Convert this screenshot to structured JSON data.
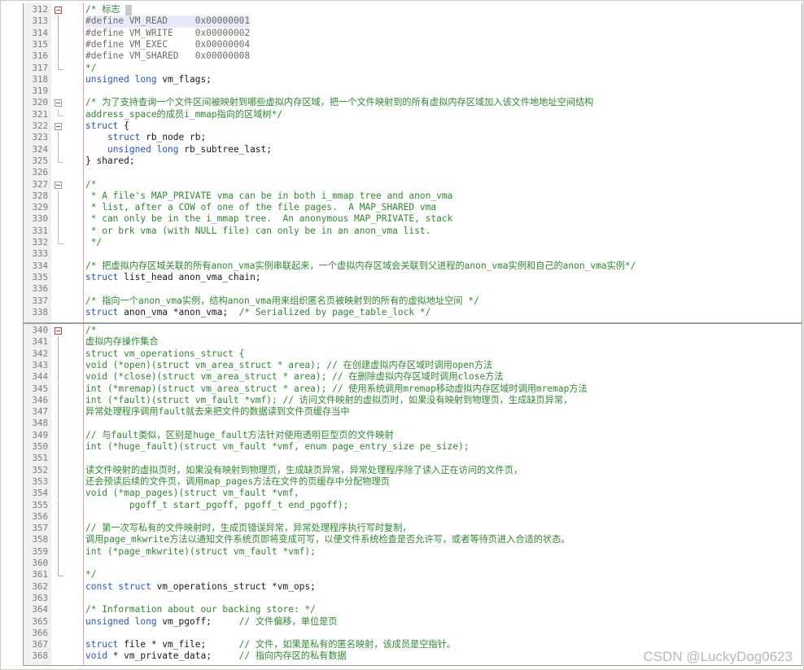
{
  "editor": {
    "watermark": "CSDN @LuckyDog0623",
    "colors": {
      "comment": "#2e8b2e",
      "keyword": "#2456c8",
      "line_number": "#7a7a7a",
      "highlight": "#e8eaf8",
      "fold_marker": "#d24040"
    },
    "panel_a": [
      {
        "n": "312",
        "fold": "open-red",
        "segs": [
          {
            "t": "/* 标志 ",
            "c": "cm"
          }
        ],
        "caret": true
      },
      {
        "n": "313",
        "fold": "line-red",
        "hl": true,
        "segs": [
          {
            "t": "#define VM_READ     0x00000001",
            "c": "pp"
          }
        ]
      },
      {
        "n": "314",
        "fold": "line-red",
        "segs": [
          {
            "t": "#define VM_WRITE    0x00000002",
            "c": "pp"
          }
        ]
      },
      {
        "n": "315",
        "fold": "line-red",
        "segs": [
          {
            "t": "#define VM_EXEC     0x00000004",
            "c": "pp"
          }
        ]
      },
      {
        "n": "316",
        "fold": "line-red",
        "segs": [
          {
            "t": "#define VM_SHARED   0x00000008",
            "c": "pp"
          }
        ]
      },
      {
        "n": "317",
        "fold": "end-red",
        "segs": [
          {
            "t": "*/",
            "c": "cm"
          }
        ]
      },
      {
        "n": "318",
        "fold": "",
        "segs": [
          {
            "t": "unsigned long",
            "c": "kw"
          },
          {
            "t": " vm_flags;",
            "c": "id"
          }
        ]
      },
      {
        "n": "319",
        "fold": "",
        "segs": []
      },
      {
        "n": "320",
        "fold": "open",
        "segs": [
          {
            "t": "/* 为了支持查询一个文件区间被映射到哪些虚拟内存区域，把一个文件映射到的所有虚拟内存区域加入该文件地地址空间结构",
            "c": "cm"
          }
        ]
      },
      {
        "n": "321",
        "fold": "end",
        "segs": [
          {
            "t": "address_space的成员i_mmap指向的区域树*/",
            "c": "cm"
          }
        ]
      },
      {
        "n": "322",
        "fold": "open",
        "segs": [
          {
            "t": "struct",
            "c": "kw"
          },
          {
            "t": " {",
            "c": "id"
          }
        ]
      },
      {
        "n": "323",
        "fold": "line",
        "segs": [
          {
            "t": "    ",
            "c": "id"
          },
          {
            "t": "struct",
            "c": "kw"
          },
          {
            "t": " rb_node rb;",
            "c": "id"
          }
        ]
      },
      {
        "n": "324",
        "fold": "line",
        "segs": [
          {
            "t": "    ",
            "c": "id"
          },
          {
            "t": "unsigned long",
            "c": "kw"
          },
          {
            "t": " rb_subtree_last;",
            "c": "id"
          }
        ]
      },
      {
        "n": "325",
        "fold": "end",
        "segs": [
          {
            "t": "} shared;",
            "c": "id"
          }
        ]
      },
      {
        "n": "326",
        "fold": "",
        "segs": []
      },
      {
        "n": "327",
        "fold": "open",
        "segs": [
          {
            "t": "/*",
            "c": "cm"
          }
        ]
      },
      {
        "n": "328",
        "fold": "line",
        "segs": [
          {
            "t": " * A file's MAP_PRIVATE vma can be in both i_mmap tree and anon_vma",
            "c": "cm"
          }
        ]
      },
      {
        "n": "329",
        "fold": "line",
        "segs": [
          {
            "t": " * list, after a COW of one of the file pages.  A MAP_SHARED vma",
            "c": "cm"
          }
        ]
      },
      {
        "n": "330",
        "fold": "line",
        "segs": [
          {
            "t": " * can only be in the i_mmap tree.  An anonymous MAP_PRIVATE, stack",
            "c": "cm"
          }
        ]
      },
      {
        "n": "331",
        "fold": "line",
        "segs": [
          {
            "t": " * or brk vma (with NULL file) can only be in an anon_vma list.",
            "c": "cm"
          }
        ]
      },
      {
        "n": "332",
        "fold": "end",
        "segs": [
          {
            "t": " */",
            "c": "cm"
          }
        ]
      },
      {
        "n": "333",
        "fold": "",
        "segs": []
      },
      {
        "n": "334",
        "fold": "",
        "segs": [
          {
            "t": "/* 把虚拟内存区域关联的所有anon_vma实例串联起来，一个虚拟内存区域会关联到父进程的anon_vma实例和自己的anon_vma实例*/",
            "c": "cm"
          }
        ]
      },
      {
        "n": "335",
        "fold": "",
        "segs": [
          {
            "t": "struct",
            "c": "kw"
          },
          {
            "t": " list_head anon_vma_chain;",
            "c": "id"
          }
        ]
      },
      {
        "n": "336",
        "fold": "",
        "segs": []
      },
      {
        "n": "337",
        "fold": "",
        "segs": [
          {
            "t": "/* 指向一个anon_vma实例，结构anon_vma用来组织匿名页被映射到的所有的虚拟地址空间 */",
            "c": "cm"
          }
        ]
      },
      {
        "n": "338",
        "fold": "",
        "segs": [
          {
            "t": "struct",
            "c": "kw"
          },
          {
            "t": " anon_vma *anon_vma;  ",
            "c": "id"
          },
          {
            "t": "/* Serialized by page_table_lock */",
            "c": "cm"
          }
        ]
      }
    ],
    "panel_b": [
      {
        "n": "340",
        "fold": "open-red",
        "segs": [
          {
            "t": "/*",
            "c": "cm"
          }
        ]
      },
      {
        "n": "341",
        "fold": "line-red",
        "segs": [
          {
            "t": "虚拟内存操作集合",
            "c": "cm"
          }
        ]
      },
      {
        "n": "342",
        "fold": "line-red",
        "segs": [
          {
            "t": "struct vm_operations_struct {",
            "c": "cm"
          }
        ]
      },
      {
        "n": "343",
        "fold": "line-red",
        "segs": [
          {
            "t": "void (*open)(struct vm_area_struct * area); // 在创建虚拟内存区域时调用open方法",
            "c": "cm"
          }
        ]
      },
      {
        "n": "344",
        "fold": "line-red",
        "segs": [
          {
            "t": "void (*close)(struct vm_area_struct * area); // 在删除虚拟内存区域时调用close方法",
            "c": "cm"
          }
        ]
      },
      {
        "n": "345",
        "fold": "line-red",
        "segs": [
          {
            "t": "int (*mremap)(struct vm_area_struct * area); // 使用系统调用mremap移动虚拟内存区域时调用mremap方法",
            "c": "cm"
          }
        ]
      },
      {
        "n": "346",
        "fold": "line-red",
        "segs": [
          {
            "t": "int (*fault)(struct vm_fault *vmf); // 访问文件映射的虚拟页时，如果没有映射到物理页，生成缺页异常，",
            "c": "cm"
          }
        ]
      },
      {
        "n": "347",
        "fold": "line-red",
        "segs": [
          {
            "t": "异常处理程序调用fault就去来把文件的数据读到文件页缓存当中",
            "c": "cm"
          }
        ]
      },
      {
        "n": "348",
        "fold": "line-red",
        "segs": []
      },
      {
        "n": "349",
        "fold": "line-red",
        "segs": [
          {
            "t": "// 与fault类似，区别是huge_fault方法针对使用透明巨型页的文件映射",
            "c": "cm"
          }
        ]
      },
      {
        "n": "350",
        "fold": "line-red",
        "segs": [
          {
            "t": "int (*huge_fault)(struct vm_fault *vmf, enum page_entry_size pe_size);",
            "c": "cm"
          }
        ]
      },
      {
        "n": "351",
        "fold": "line-red",
        "segs": []
      },
      {
        "n": "352",
        "fold": "line-red",
        "segs": [
          {
            "t": "读文件映射的虚拟页时，如果没有映射到物理页，生成缺页异常，异常处理程序除了读入正在访问的文件页，",
            "c": "cm"
          }
        ]
      },
      {
        "n": "353",
        "fold": "line-red",
        "segs": [
          {
            "t": "还会预读后续的文件页，调用map_pages方法在文件的页缓存中分配物理页",
            "c": "cm"
          }
        ]
      },
      {
        "n": "354",
        "fold": "line-red",
        "segs": [
          {
            "t": "void (*map_pages)(struct vm_fault *vmf,",
            "c": "cm"
          }
        ]
      },
      {
        "n": "355",
        "fold": "line-red",
        "segs": [
          {
            "t": "        pgoff_t start_pgoff, pgoff_t end_pgoff);",
            "c": "cm"
          }
        ]
      },
      {
        "n": "356",
        "fold": "line-red",
        "segs": []
      },
      {
        "n": "357",
        "fold": "line-red",
        "segs": [
          {
            "t": "// 第一次写私有的文件映射时，生成页错误异常，异常处理程序执行写时复制，",
            "c": "cm"
          }
        ]
      },
      {
        "n": "358",
        "fold": "line-red",
        "segs": [
          {
            "t": "调用page_mkwrite方法以通知文件系统页即将变成可写，以便文件系统检查是否允许写，或者等待页进入合适的状态。",
            "c": "cm"
          }
        ]
      },
      {
        "n": "359",
        "fold": "line-red",
        "segs": [
          {
            "t": "int (*page_mkwrite)(struct vm_fault *vmf);",
            "c": "cm"
          }
        ]
      },
      {
        "n": "360",
        "fold": "line-red",
        "segs": []
      },
      {
        "n": "361",
        "fold": "end-red",
        "segs": [
          {
            "t": "*/",
            "c": "cm"
          }
        ]
      },
      {
        "n": "362",
        "fold": "",
        "segs": [
          {
            "t": "const struct",
            "c": "kw"
          },
          {
            "t": " vm_operations_struct *vm_ops;",
            "c": "id"
          }
        ]
      },
      {
        "n": "363",
        "fold": "",
        "segs": []
      },
      {
        "n": "364",
        "fold": "",
        "segs": [
          {
            "t": "/* Information about our backing store: */",
            "c": "cm"
          }
        ]
      },
      {
        "n": "365",
        "fold": "",
        "segs": [
          {
            "t": "unsigned long",
            "c": "kw"
          },
          {
            "t": " vm_pgoff;     ",
            "c": "id"
          },
          {
            "t": "// 文件偏移，单位是页",
            "c": "cm"
          }
        ]
      },
      {
        "n": "366",
        "fold": "",
        "segs": []
      },
      {
        "n": "367",
        "fold": "",
        "segs": [
          {
            "t": "struct",
            "c": "kw"
          },
          {
            "t": " file * vm_file;      ",
            "c": "id"
          },
          {
            "t": "// 文件，如果是私有的匿名映射，该成员是空指针。",
            "c": "cm"
          }
        ]
      },
      {
        "n": "368",
        "fold": "",
        "segs": [
          {
            "t": "void",
            "c": "kw"
          },
          {
            "t": " * vm_private_data;     ",
            "c": "id"
          },
          {
            "t": "// 指向内存区的私有数据",
            "c": "cm"
          }
        ]
      }
    ]
  }
}
